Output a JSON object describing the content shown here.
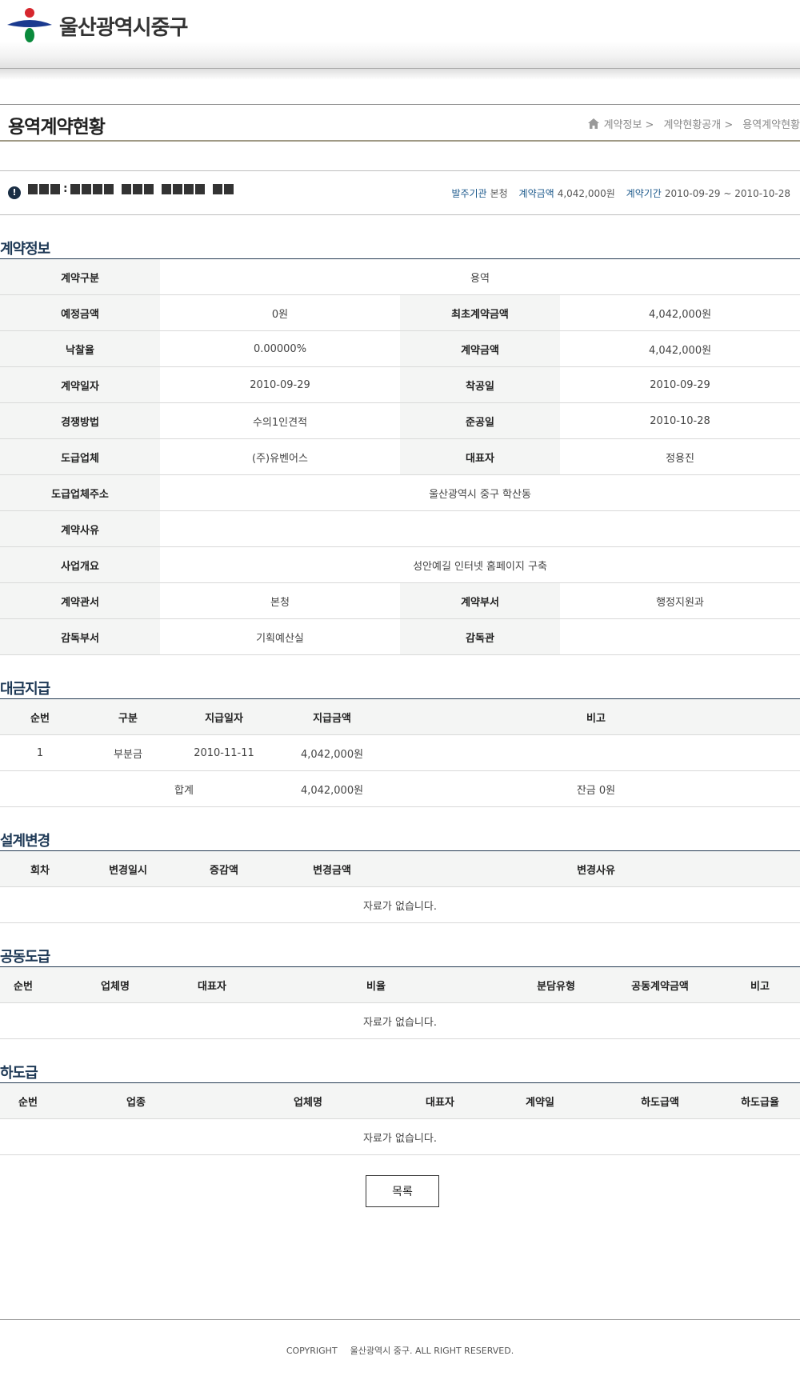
{
  "header": {
    "site_name": "울산광역시중구",
    "logo_colors": {
      "red": "#d6272e",
      "blue": "#1a3a8f",
      "green": "#0a8a3c"
    }
  },
  "page": {
    "title": "용역계약현황",
    "breadcrumb": [
      "계약정보 >",
      "계약현황공개 >",
      "용역계약현황"
    ]
  },
  "summary": {
    "colon": ":",
    "agency_label": "발주기관",
    "agency_value": "본청",
    "amount_label": "계약금액",
    "amount_value": "4,042,000원",
    "period_label": "계약기간",
    "period_value": "2010-09-29 ~ 2010-10-28"
  },
  "contract_info": {
    "title": "계약정보",
    "rows": [
      {
        "label1": "계약구분",
        "value1": "용역"
      },
      {
        "label1": "예정금액",
        "value1": "0원",
        "label2": "최초계약금액",
        "value2": "4,042,000원"
      },
      {
        "label1": "낙찰율",
        "value1": "0.00000%",
        "label2": "계약금액",
        "value2": "4,042,000원"
      },
      {
        "label1": "계약일자",
        "value1": "2010-09-29",
        "label2": "착공일",
        "value2": "2010-09-29"
      },
      {
        "label1": "경쟁방법",
        "value1": "수의1인견적",
        "label2": "준공일",
        "value2": "2010-10-28"
      },
      {
        "label1": "도급업체",
        "value1": "(주)유벤어스",
        "label2": "대표자",
        "value2": "정용진"
      },
      {
        "label1": "도급업체주소",
        "value1": "울산광역시 중구 학산동"
      },
      {
        "label1": "계약사유",
        "value1": ""
      },
      {
        "label1": "사업개요",
        "value1": "성안예길 인터넷 홈페이지 구축"
      },
      {
        "label1": "계약관서",
        "value1": "본청",
        "label2": "계약부서",
        "value2": "행정지원과"
      },
      {
        "label1": "감독부서",
        "value1": "기획예산실",
        "label2": "감독관",
        "value2": ""
      }
    ]
  },
  "payment": {
    "title": "대금지급",
    "headers": [
      "순번",
      "구분",
      "지급일자",
      "지급금액",
      "비고"
    ],
    "rows": [
      [
        "1",
        "부분금",
        "2010-11-11",
        "4,042,000원",
        ""
      ]
    ],
    "total": {
      "label": "합계",
      "amount": "4,042,000원",
      "note": "잔금 0원"
    }
  },
  "design_change": {
    "title": "설계변경",
    "headers": [
      "회차",
      "변경일시",
      "증감액",
      "변경금액",
      "변경사유"
    ],
    "empty": "자료가 없습니다."
  },
  "joint": {
    "title": "공동도급",
    "headers": [
      "순번",
      "업체명",
      "대표자",
      "비율",
      "분담유형",
      "공동계약금액",
      "비고"
    ],
    "empty": "자료가 없습니다."
  },
  "subcontract": {
    "title": "하도급",
    "headers": [
      "순번",
      "업종",
      "업체명",
      "대표자",
      "계약일",
      "하도급액",
      "하도급율"
    ],
    "empty": "자료가 없습니다."
  },
  "list_button": "목록",
  "footer": {
    "copyright": "COPYRIGHT",
    "text": "울산광역시 중구. ALL RIGHT RESERVED."
  }
}
